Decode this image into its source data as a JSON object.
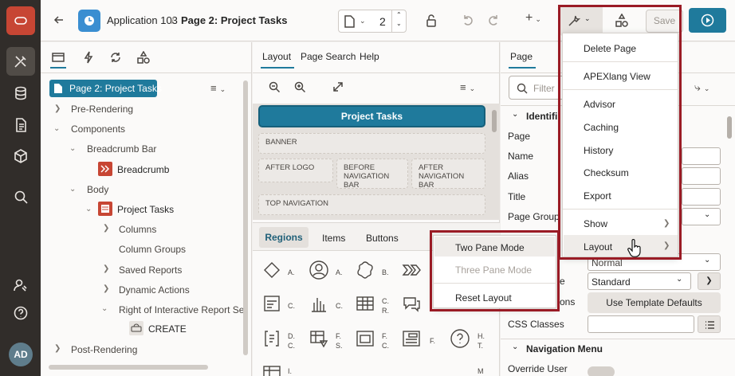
{
  "header": {
    "app_name": "Application 103",
    "page_name": "Page 2: Project Tasks",
    "page_number": "2",
    "save_label": "Save"
  },
  "left_pane": {
    "selected_node": "Page 2: Project Tasks",
    "tree": [
      {
        "label": "Pre-Rendering"
      },
      {
        "label": "Components"
      },
      {
        "label": "Breadcrumb Bar"
      },
      {
        "label": "Breadcrumb"
      },
      {
        "label": "Body"
      },
      {
        "label": "Project Tasks"
      },
      {
        "label": "Columns"
      },
      {
        "label": "Column Groups"
      },
      {
        "label": "Saved Reports"
      },
      {
        "label": "Dynamic Actions"
      },
      {
        "label": "Right of Interactive Report Searc"
      },
      {
        "label": "CREATE"
      },
      {
        "label": "Post-Rendering"
      }
    ]
  },
  "center_pane": {
    "tabs": [
      "Layout",
      "Page Search",
      "Help"
    ],
    "region_title": "Project Tasks",
    "positions": {
      "banner": "BANNER",
      "after_logo": "AFTER LOGO",
      "before_nav_1": "BEFORE",
      "before_nav_2": "NAVIGATION BAR",
      "after_nav_1": "AFTER",
      "after_nav_2": "NAVIGATION BAR",
      "top_nav": "TOP NAVIGATION"
    },
    "gallery_tabs": [
      "Regions",
      "Items",
      "Buttons"
    ],
    "gallery_labels": [
      "A.",
      "A.",
      "B.",
      "C.",
      "C.",
      "C.",
      "R.",
      "D.",
      "C.",
      "F.",
      "S.",
      "F.",
      "C.",
      "F.",
      "H.",
      "T.",
      "I.",
      "M"
    ]
  },
  "right_pane": {
    "tab": "Page",
    "filter_placeholder": "Filter",
    "section_identification": "Identifi",
    "labels": [
      "Page",
      "Name",
      "Alias",
      "Title",
      "Page Group"
    ],
    "partial_label": "e",
    "partial_label2": "ons",
    "template_value": "Normal",
    "template_options_value": "Standard",
    "template_defaults_button": "Use Template Defaults",
    "css_classes_label": "CSS Classes",
    "nav_menu_section": "Navigation Menu",
    "override_user_label": "Override User"
  },
  "utilities_menu": {
    "items": [
      "Delete Page",
      "APEXlang View",
      "Advisor",
      "Caching",
      "History",
      "Checksum",
      "Export",
      "Show",
      "Layout"
    ]
  },
  "layout_submenu": {
    "items": [
      "Two Pane Mode",
      "Three Pane Mode",
      "Reset Layout"
    ]
  },
  "avatar_initials": "AD",
  "colors": {
    "accent": "#1f7a9c",
    "highlight_outline": "#9a1b25",
    "brand": "#c74634"
  }
}
